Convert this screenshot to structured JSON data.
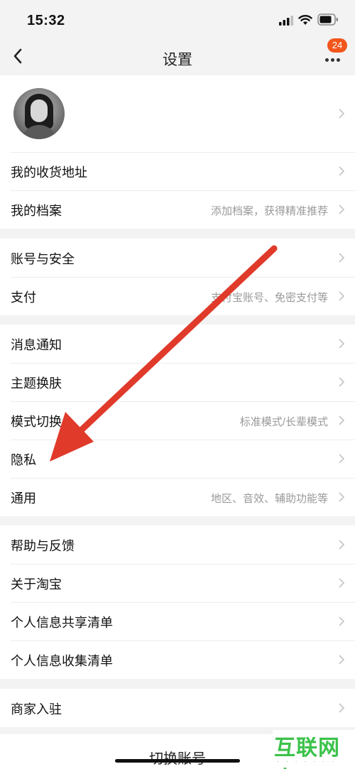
{
  "status_bar": {
    "time": "15:32"
  },
  "nav": {
    "title": "设置",
    "badge": "24"
  },
  "groups": [
    {
      "rows": [
        {
          "label": "我的收货地址",
          "hint": ""
        },
        {
          "label": "我的档案",
          "hint": "添加档案，获得精准推荐"
        }
      ]
    },
    {
      "rows": [
        {
          "label": "账号与安全",
          "hint": ""
        },
        {
          "label": "支付",
          "hint": "支付宝账号、免密支付等"
        }
      ]
    },
    {
      "rows": [
        {
          "label": "消息通知",
          "hint": ""
        },
        {
          "label": "主题换肤",
          "hint": ""
        },
        {
          "label": "模式切换",
          "hint": "标准模式/长辈模式"
        },
        {
          "label": "隐私",
          "hint": ""
        },
        {
          "label": "通用",
          "hint": "地区、音效、辅助功能等"
        }
      ]
    },
    {
      "rows": [
        {
          "label": "帮助与反馈",
          "hint": ""
        },
        {
          "label": "关于淘宝",
          "hint": ""
        },
        {
          "label": "个人信息共享清单",
          "hint": ""
        },
        {
          "label": "个人信息收集清单",
          "hint": ""
        }
      ]
    },
    {
      "rows": [
        {
          "label": "商家入驻",
          "hint": ""
        }
      ]
    }
  ],
  "bottom": {
    "switch_account": "切换账号"
  },
  "watermark": {
    "text": "互联网应用"
  },
  "colors": {
    "accent": "#f2561d",
    "annotation": "#e03a2b",
    "watermark": "#3cc24a"
  }
}
